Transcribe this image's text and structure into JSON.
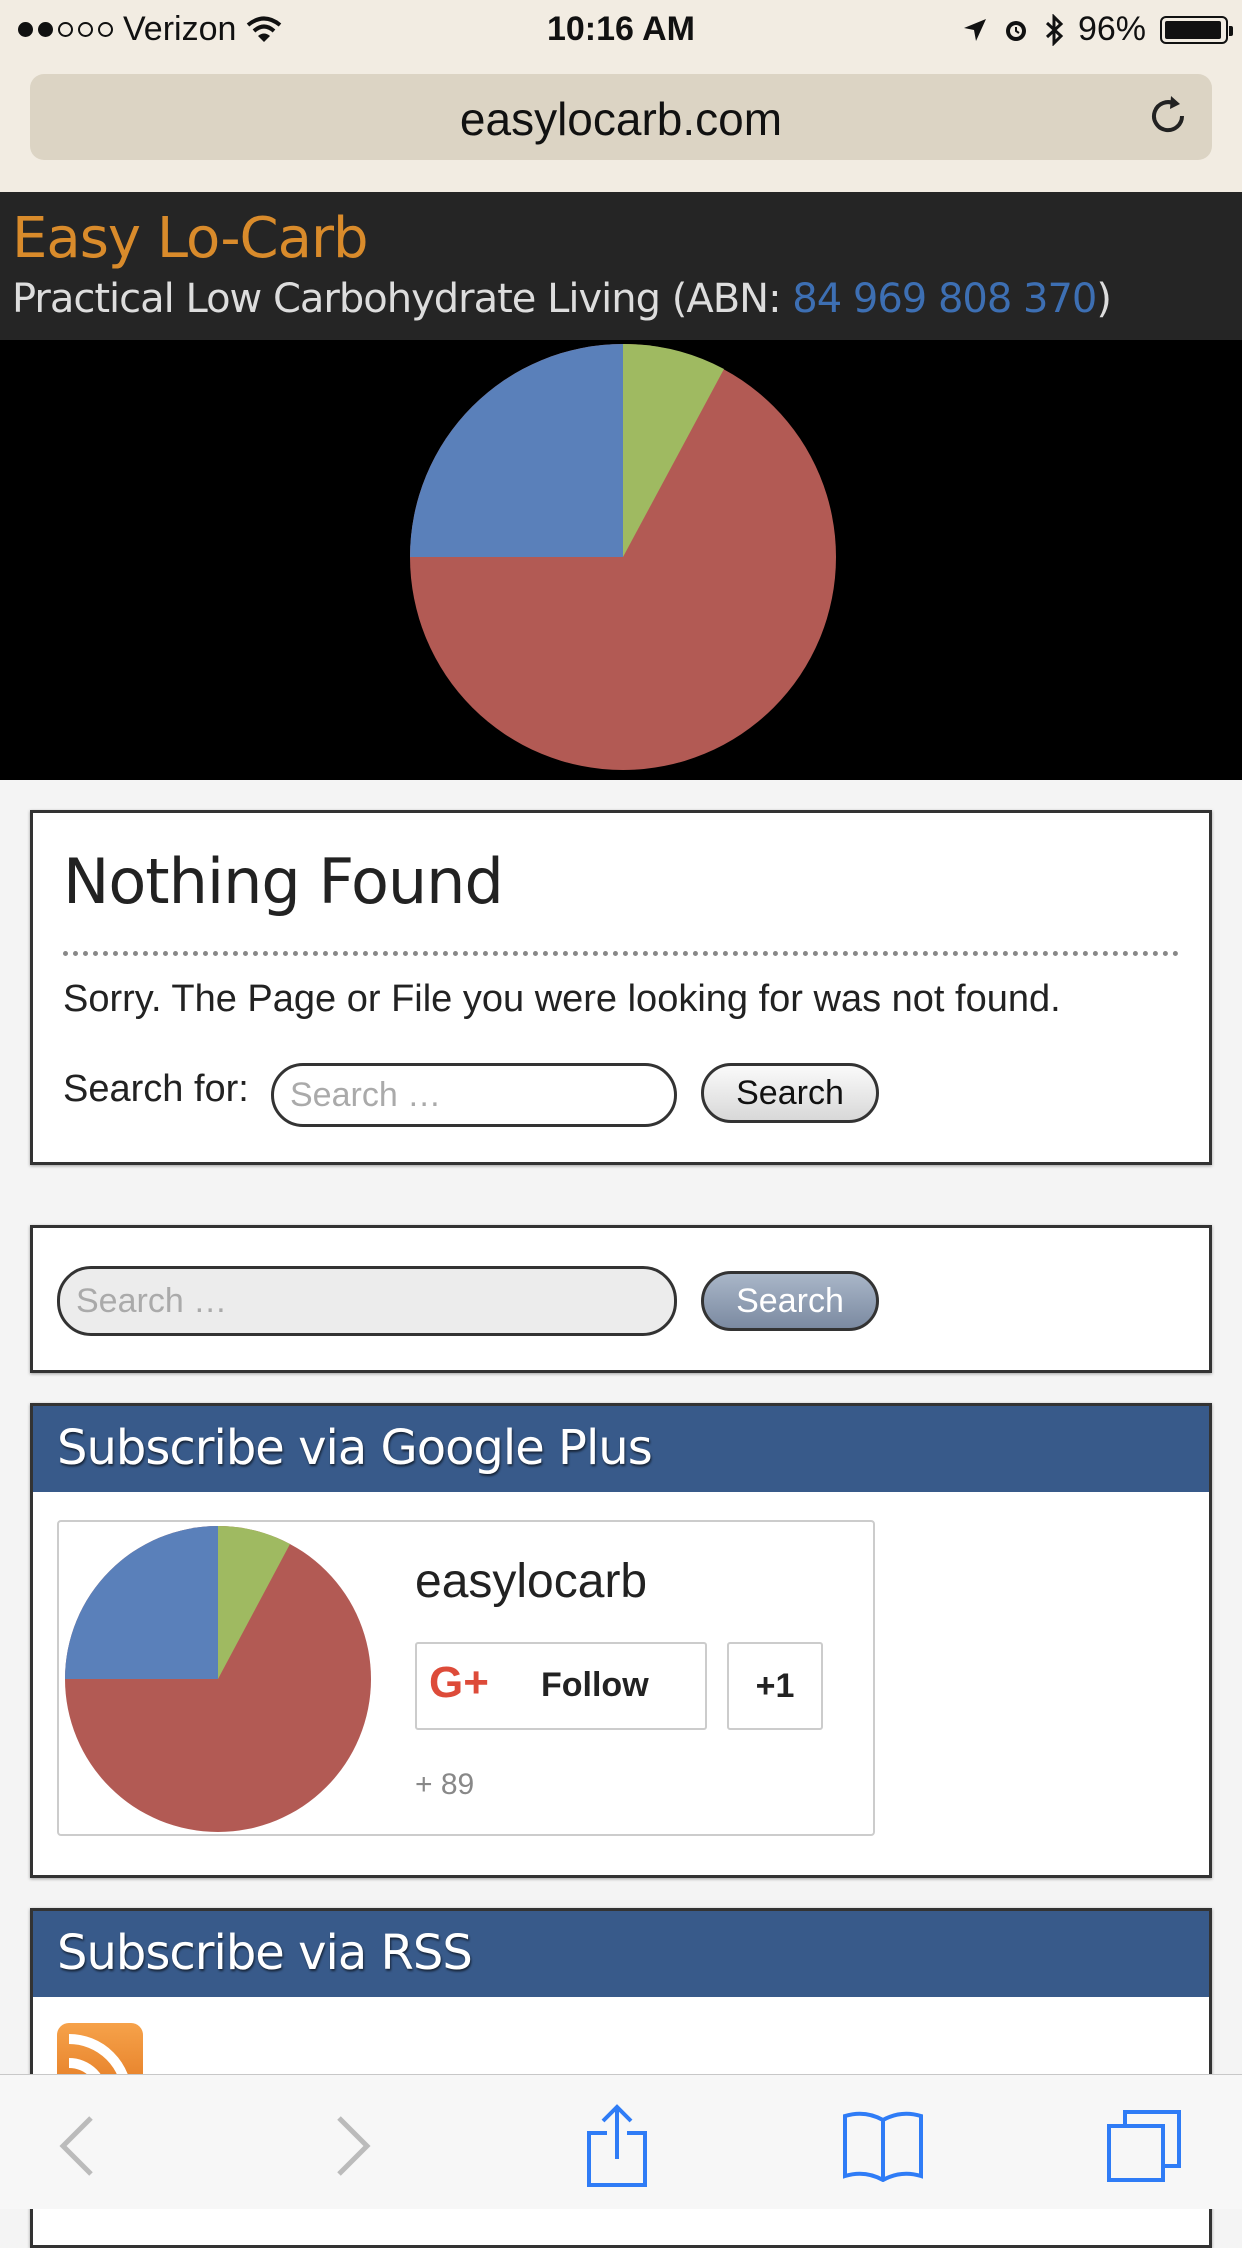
{
  "status_bar": {
    "carrier": "Verizon",
    "time": "10:16 AM",
    "battery": "96%",
    "battery_level": 0.96,
    "signal_bars_filled": 2,
    "signal_bars_total": 5
  },
  "browser": {
    "url": "easylocarb.com"
  },
  "site": {
    "title": "Easy Lo-Carb",
    "tagline_prefix": "Practical Low Carbohydrate Living (ABN: ",
    "abn": "84 969 808 370",
    "tagline_suffix": ")"
  },
  "not_found": {
    "title": "Nothing Found",
    "message": "Sorry. The Page or File you were looking for was not found.",
    "search_label": "Search for:",
    "search_placeholder": "Search …",
    "search_button": "Search"
  },
  "search_widget": {
    "placeholder": "Search …",
    "button": "Search"
  },
  "google_plus": {
    "heading": "Subscribe via Google Plus",
    "name": "easylocarb",
    "gplus_glyph": "G+",
    "follow_label": "Follow",
    "plus_one_label": "+1",
    "follower_count": "+ 89"
  },
  "rss": {
    "heading": "Subscribe via RSS"
  },
  "logo_colors": {
    "slice_green": "#9fba61",
    "slice_red": "#b25a54",
    "slice_blue": "#5a80ba"
  },
  "icons": {
    "back": "back-chevron-icon",
    "forward": "forward-chevron-icon",
    "share": "share-icon",
    "bookmarks": "bookmarks-icon",
    "tabs": "tabs-icon"
  }
}
